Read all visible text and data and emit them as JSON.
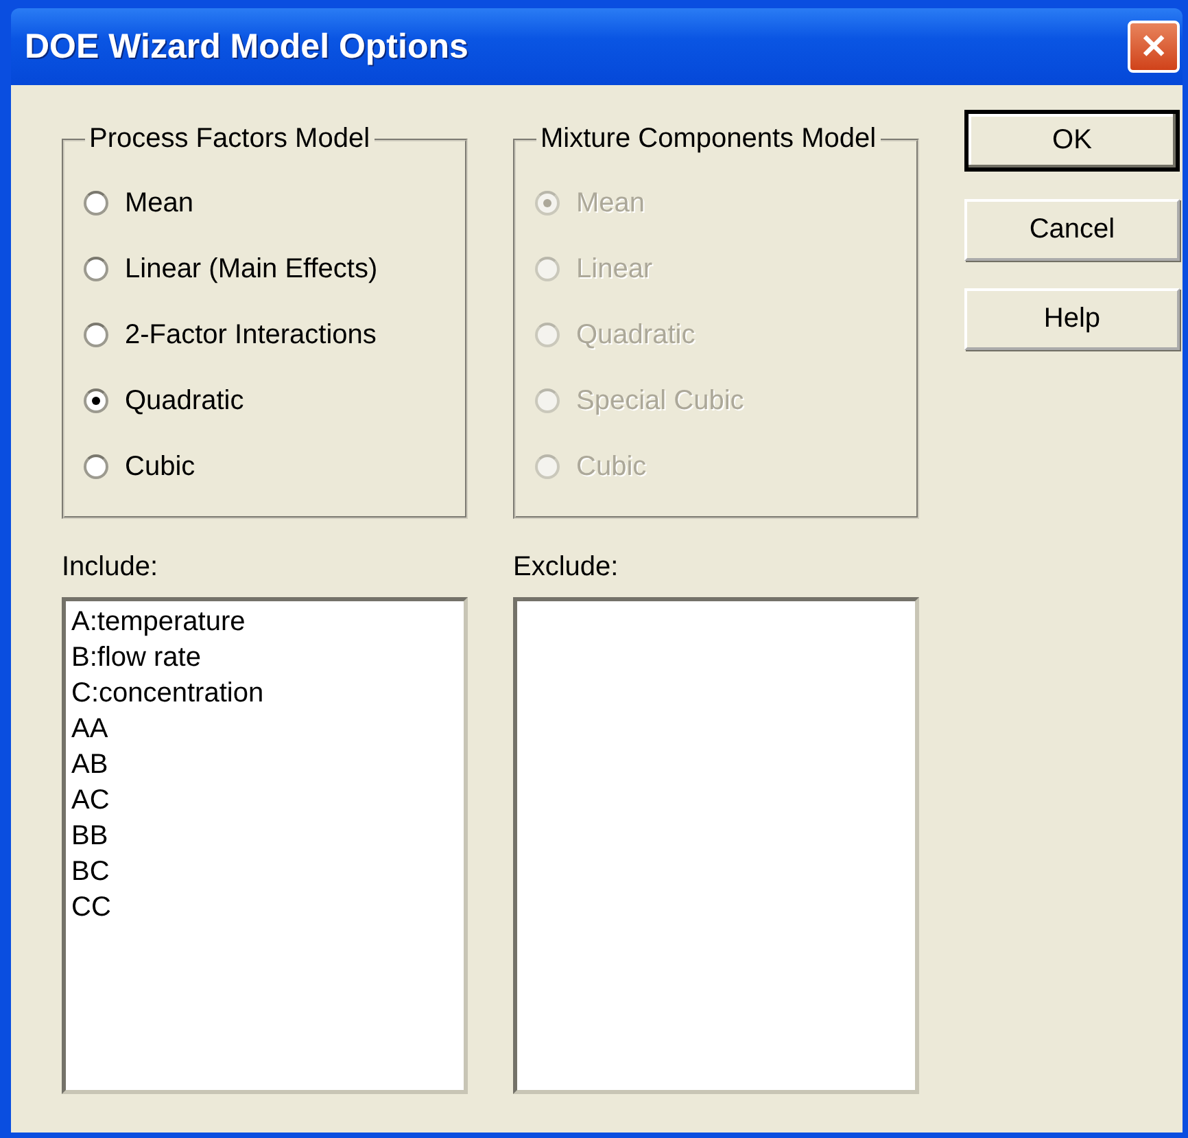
{
  "window": {
    "title": "DOE Wizard Model Options",
    "close": "✕"
  },
  "groups": [
    {
      "title": "Process Factors Model",
      "disabled": false,
      "options": [
        {
          "label": "Mean",
          "selected": false
        },
        {
          "label": "Linear (Main Effects)",
          "selected": false
        },
        {
          "label": "2-Factor Interactions",
          "selected": false
        },
        {
          "label": "Quadratic",
          "selected": true
        },
        {
          "label": "Cubic",
          "selected": false
        }
      ]
    },
    {
      "title": "Mixture Components Model",
      "disabled": true,
      "options": [
        {
          "label": "Mean",
          "selected": true
        },
        {
          "label": "Linear",
          "selected": false
        },
        {
          "label": "Quadratic",
          "selected": false
        },
        {
          "label": "Special Cubic",
          "selected": false
        },
        {
          "label": "Cubic",
          "selected": false
        }
      ]
    }
  ],
  "lists": [
    {
      "label": "Include:",
      "items": [
        "A:temperature",
        "B:flow rate",
        "C:concentration",
        "AA",
        "AB",
        "AC",
        "BB",
        "BC",
        "CC"
      ]
    },
    {
      "label": "Exclude:"
    }
  ],
  "buttons": [
    {
      "label": "OK",
      "default": true
    },
    {
      "label": "Cancel",
      "default": false
    },
    {
      "label": "Help",
      "default": false
    }
  ]
}
